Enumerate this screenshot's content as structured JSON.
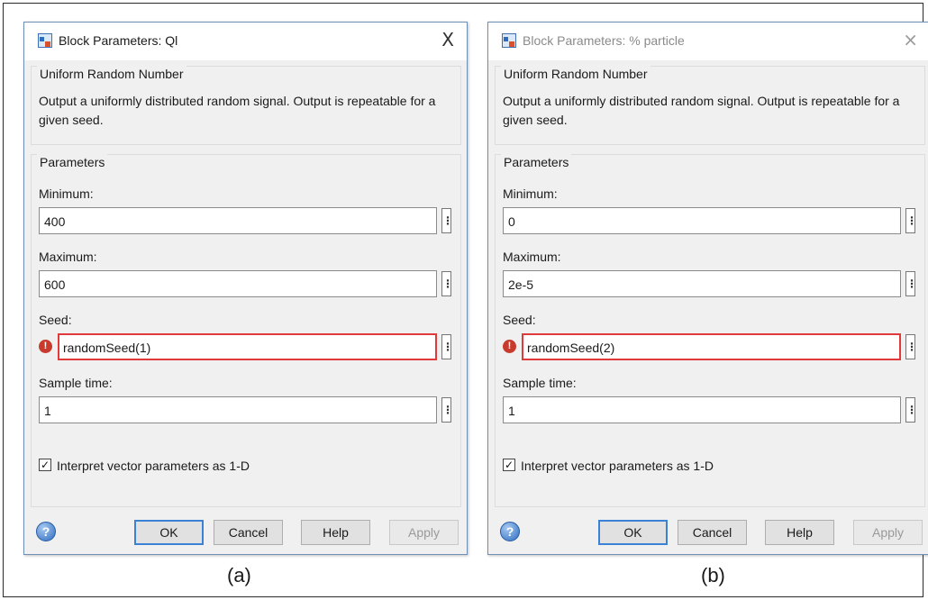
{
  "dialogs": [
    {
      "title": "Block Parameters: Ql",
      "close": "X",
      "block_name": "Uniform Random Number",
      "description": "Output a uniformly distributed random signal.  Output is repeatable for a given seed.",
      "parameters_label": "Parameters",
      "minimum_label": "Minimum:",
      "minimum_value": "400",
      "maximum_label": "Maximum:",
      "maximum_value": "600",
      "seed_label": "Seed:",
      "seed_value": "randomSeed(1)",
      "sample_time_label": "Sample time:",
      "sample_time_value": "1",
      "interpret_label": "Interpret vector parameters as 1-D",
      "interpret_checked": true,
      "buttons": {
        "ok": "OK",
        "cancel": "Cancel",
        "help": "Help",
        "apply": "Apply"
      }
    },
    {
      "title": "Block Parameters: % particle",
      "close": "×",
      "block_name": "Uniform Random Number",
      "description": "Output a uniformly distributed random signal.  Output is repeatable for a given seed.",
      "parameters_label": "Parameters",
      "minimum_label": "Minimum:",
      "minimum_value": "0",
      "maximum_label": "Maximum:",
      "maximum_value": "2e-5",
      "seed_label": "Seed:",
      "seed_value": "randomSeed(2)",
      "sample_time_label": "Sample time:",
      "sample_time_value": "1",
      "interpret_label": "Interpret vector parameters as 1-D",
      "interpret_checked": true,
      "buttons": {
        "ok": "OK",
        "cancel": "Cancel",
        "help": "Help",
        "apply": "Apply"
      }
    }
  ],
  "captions": [
    "(a)",
    "(b)"
  ],
  "icons": {
    "more": "⋮",
    "error": "!",
    "help": "?",
    "check": "✓"
  },
  "colors": {
    "error_border": "#e03a3a",
    "primary_button_border": "#3b82d6",
    "window_border": "#6f8fb5"
  }
}
